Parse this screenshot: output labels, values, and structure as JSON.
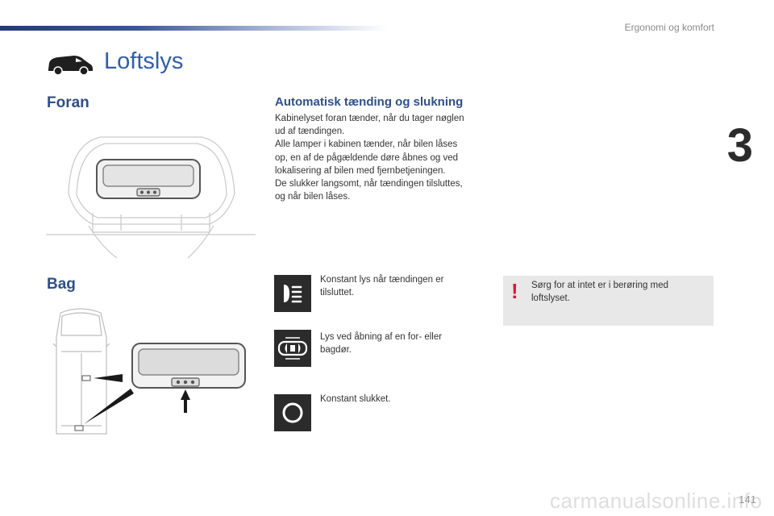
{
  "header": {
    "section": "Ergonomi og komfort",
    "chapter": "3"
  },
  "page": {
    "title": "Loftslys",
    "number": "141"
  },
  "front": {
    "heading": "Foran"
  },
  "rear": {
    "heading": "Bag"
  },
  "auto": {
    "heading": "Automatisk tænding og slukning",
    "lines": [
      "Kabinelyset foran tænder, når du tager nøglen",
      "ud af tændingen.",
      "Alle lamper i kabinen tænder, når bilen låses",
      "op, en af de pågældende døre åbnes og ved",
      "lokalisering af bilen med fjernbetjeningen.",
      "De slukker langsomt, når tændingen tilsluttes,",
      "og når bilen låses."
    ]
  },
  "modes": [
    {
      "icon": "constant-light-icon",
      "lines": [
        "Konstant lys når tændingen er",
        "tilsluttet."
      ]
    },
    {
      "icon": "door-light-icon",
      "lines": [
        "Lys ved åbning af en for- eller",
        "bagdør."
      ]
    },
    {
      "icon": "off-icon",
      "lines": [
        "Konstant slukket."
      ]
    }
  ],
  "warning": {
    "mark": "!",
    "lines": [
      "Sørg for at intet er i berøring med",
      "loftslyset."
    ]
  },
  "watermark": "carmanualsonline.info"
}
